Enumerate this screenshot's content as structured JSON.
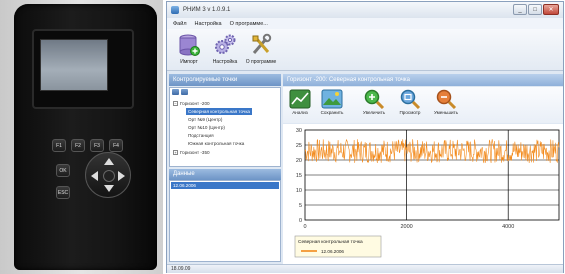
{
  "window": {
    "title": "РНИМ 3 v 1.0.9.1"
  },
  "menu": {
    "items": [
      "Файл",
      "Настройка",
      "О программе..."
    ]
  },
  "toolbar": {
    "import_label": "Импорт",
    "settings_label": "Настройка",
    "about_label": "О программе"
  },
  "left_panel": {
    "title": "Контролируемые точки",
    "tree": {
      "root1": "Горизонт -200",
      "items": [
        "Северная контрольная точка",
        "Орт №9 (Центр)",
        "Орт №10 (Центр)",
        "Подстанция",
        "Южная контрольная точка"
      ],
      "root2": "Горизонт -350"
    }
  },
  "dates_panel": {
    "title": "Данные",
    "selected_date": "12.06.2006"
  },
  "chart_panel": {
    "title": "Горизонт -200: Северная контрольная точка",
    "tools": {
      "analysis_label": "Анализ",
      "save_label": "Сохранить",
      "zoom_in_label": "Увеличить",
      "view_label": "Просмотр",
      "zoom_out_label": "Уменьшить"
    }
  },
  "status": {
    "text": "18.09.09"
  },
  "colors": {
    "series": "#f28a1c",
    "accent": "#3a77c8",
    "header": "#6d94c6"
  },
  "chart_data": {
    "type": "line",
    "title": "",
    "xlabel": "",
    "ylabel": "",
    "xlim": [
      0,
      5000
    ],
    "ylim": [
      0,
      30
    ],
    "x_ticks": [
      0,
      2000,
      4000
    ],
    "y_ticks": [
      0,
      5,
      10,
      15,
      20,
      25,
      30
    ],
    "grid": true,
    "legend_position": "bottom-left",
    "legend_title": "Северная контрольная точка",
    "series": [
      {
        "name": "12.06.2006",
        "color": "#f28a1c",
        "x_range": [
          0,
          5000
        ],
        "min": 19,
        "max": 27,
        "mean": 23
      }
    ]
  }
}
